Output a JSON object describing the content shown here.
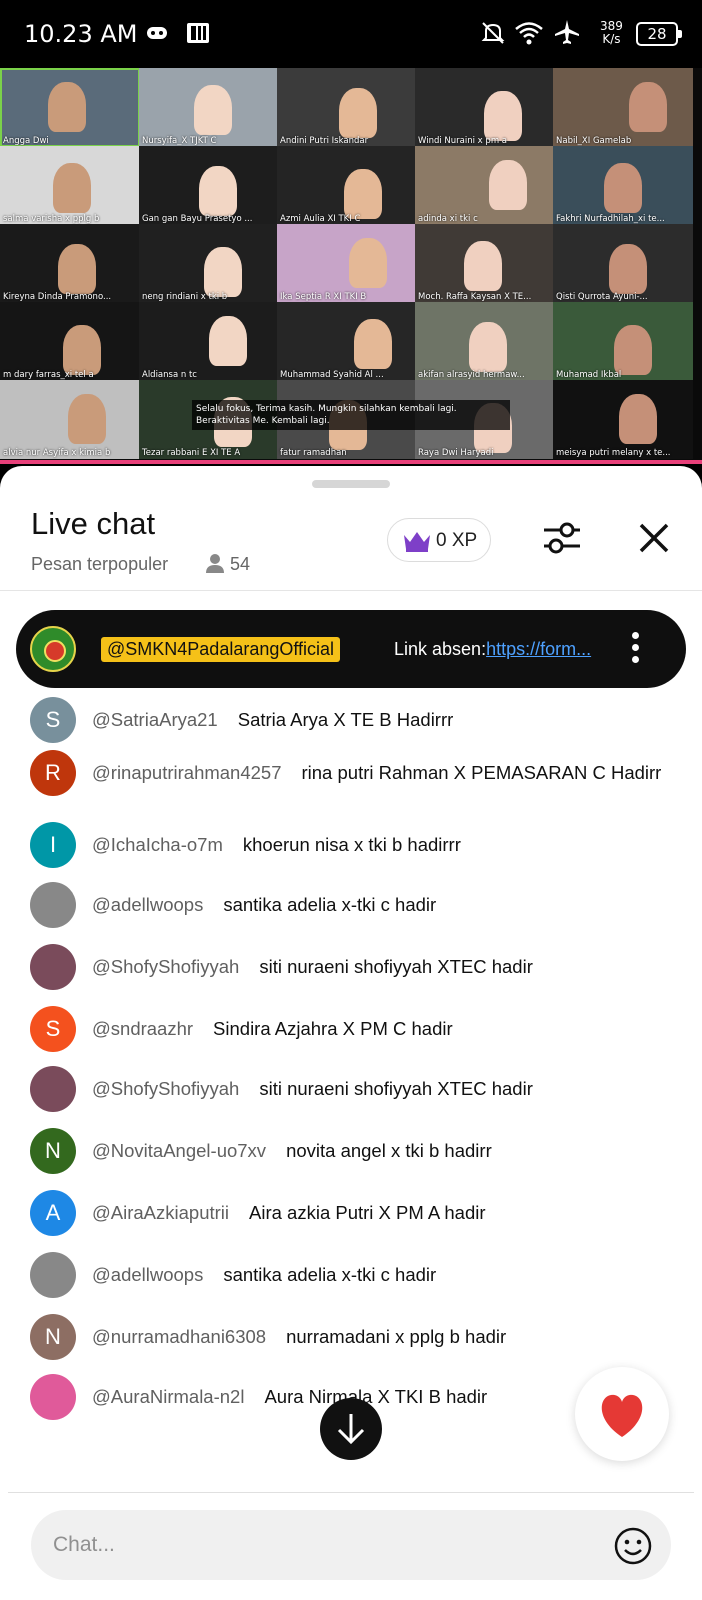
{
  "status_bar": {
    "time": "10.23 AM",
    "speed_value": "389",
    "speed_unit": "K/s",
    "battery": "28",
    "icons": [
      "gamepad-icon",
      "app-icon",
      "mute-icon",
      "wifi-icon",
      "airplane-icon",
      "battery-icon"
    ]
  },
  "video": {
    "participants": [
      "Angga Dwi",
      "Nursyifa_X TJKT C",
      "Andini Putri Iskandar",
      "Windi Nuraini x pm a",
      "Nabil_XI Gamelab",
      "salma varisha x pplg b",
      "Gan gan Bayu Prasetyo ...",
      "Azmi Aulia XI TKI C",
      "adinda xi tki c",
      "Fakhri Nurfadhilah_xi te...",
      "Kireyna Dinda Pramono...",
      "neng rindiani x tki b",
      "Ika Septia R XI TKI B",
      "Moch. Raffa Kaysan X TE...",
      "Qisti Qurrota Ayuni-...",
      "m dary farras_xi tel a",
      "Aldiansa n tc",
      "Muhammad Syahid Al ...",
      "akifan alrasyid hermaw...",
      "Muhamad Ikbal",
      "alvia nur Asyifa x kimia b",
      "Tezar rabbani E XI TE A",
      "fatur ramadhan",
      "Raya Dwi Haryadi",
      "meisya putri melany x te..."
    ],
    "subtitle": "Selalu fokus, Terima kasih. Mungkin silahkan kembali lagi. Beraktivitas Me. Kembali lagi."
  },
  "live_chat": {
    "title": "Live chat",
    "subtitle": "Pesan terpopuler",
    "viewer_count": "54",
    "xp": "0 XP",
    "pinned": {
      "handle": "@SMKN4PadalarangOfficial",
      "text_prefix": "Link absen:",
      "link": "https://form..."
    },
    "messages": [
      {
        "author": "@adellwoops",
        "text": "santika adelia x-tki c hadir",
        "avatar_letter": "",
        "avatar_color": "#888888"
      },
      {
        "author": "@SatriaArya21",
        "text": "Satria Arya X TE B Hadirrr",
        "avatar_letter": "S",
        "avatar_color": "#78909c"
      },
      {
        "author": "@rinaputrirahman4257",
        "text": "rina putri Rahman X PEMASARAN C Hadirr",
        "avatar_letter": "R",
        "avatar_color": "#bf360c"
      },
      {
        "author": "@IchaIcha-o7m",
        "text": "khoerun nisa x tki b hadirrr",
        "avatar_letter": "I",
        "avatar_color": "#0097a7"
      },
      {
        "author": "@adellwoops",
        "text": "santika adelia x-tki c hadir",
        "avatar_letter": "",
        "avatar_color": "#888888"
      },
      {
        "author": "@ShofyShofiyyah",
        "text": "siti nuraeni shofiyyah XTEC hadir",
        "avatar_letter": "",
        "avatar_color": "#7a4b5b"
      },
      {
        "author": "@sndraazhr",
        "text": "Sindira Azjahra X PM C hadir",
        "avatar_letter": "S",
        "avatar_color": "#f4511e"
      },
      {
        "author": "@ShofyShofiyyah",
        "text": "siti nuraeni shofiyyah XTEC hadir",
        "avatar_letter": "",
        "avatar_color": "#7a4b5b"
      },
      {
        "author": "@NovitaAngel-uo7xv",
        "text": "novita angel x tki b hadirr",
        "avatar_letter": "N",
        "avatar_color": "#33691e"
      },
      {
        "author": "@AiraAzkiaputrii",
        "text": "Aira azkia Putri X PM A hadir",
        "avatar_letter": "A",
        "avatar_color": "#1e88e5"
      },
      {
        "author": "@adellwoops",
        "text": "santika adelia x-tki c hadir",
        "avatar_letter": "",
        "avatar_color": "#888888"
      },
      {
        "author": "@nurramadhani6308",
        "text": "nurramadani x pplg b hadir",
        "avatar_letter": "N",
        "avatar_color": "#8d6e63"
      },
      {
        "author": "@AuraNirmala-n2l",
        "text": "Aura Nirmala X TKI B hadir",
        "avatar_letter": "",
        "avatar_color": "#e05a9a"
      }
    ],
    "input_placeholder": "Chat...",
    "heart_color": "#e53935",
    "accent_pin": "#f5c118",
    "link_color": "#4ea1ff"
  }
}
